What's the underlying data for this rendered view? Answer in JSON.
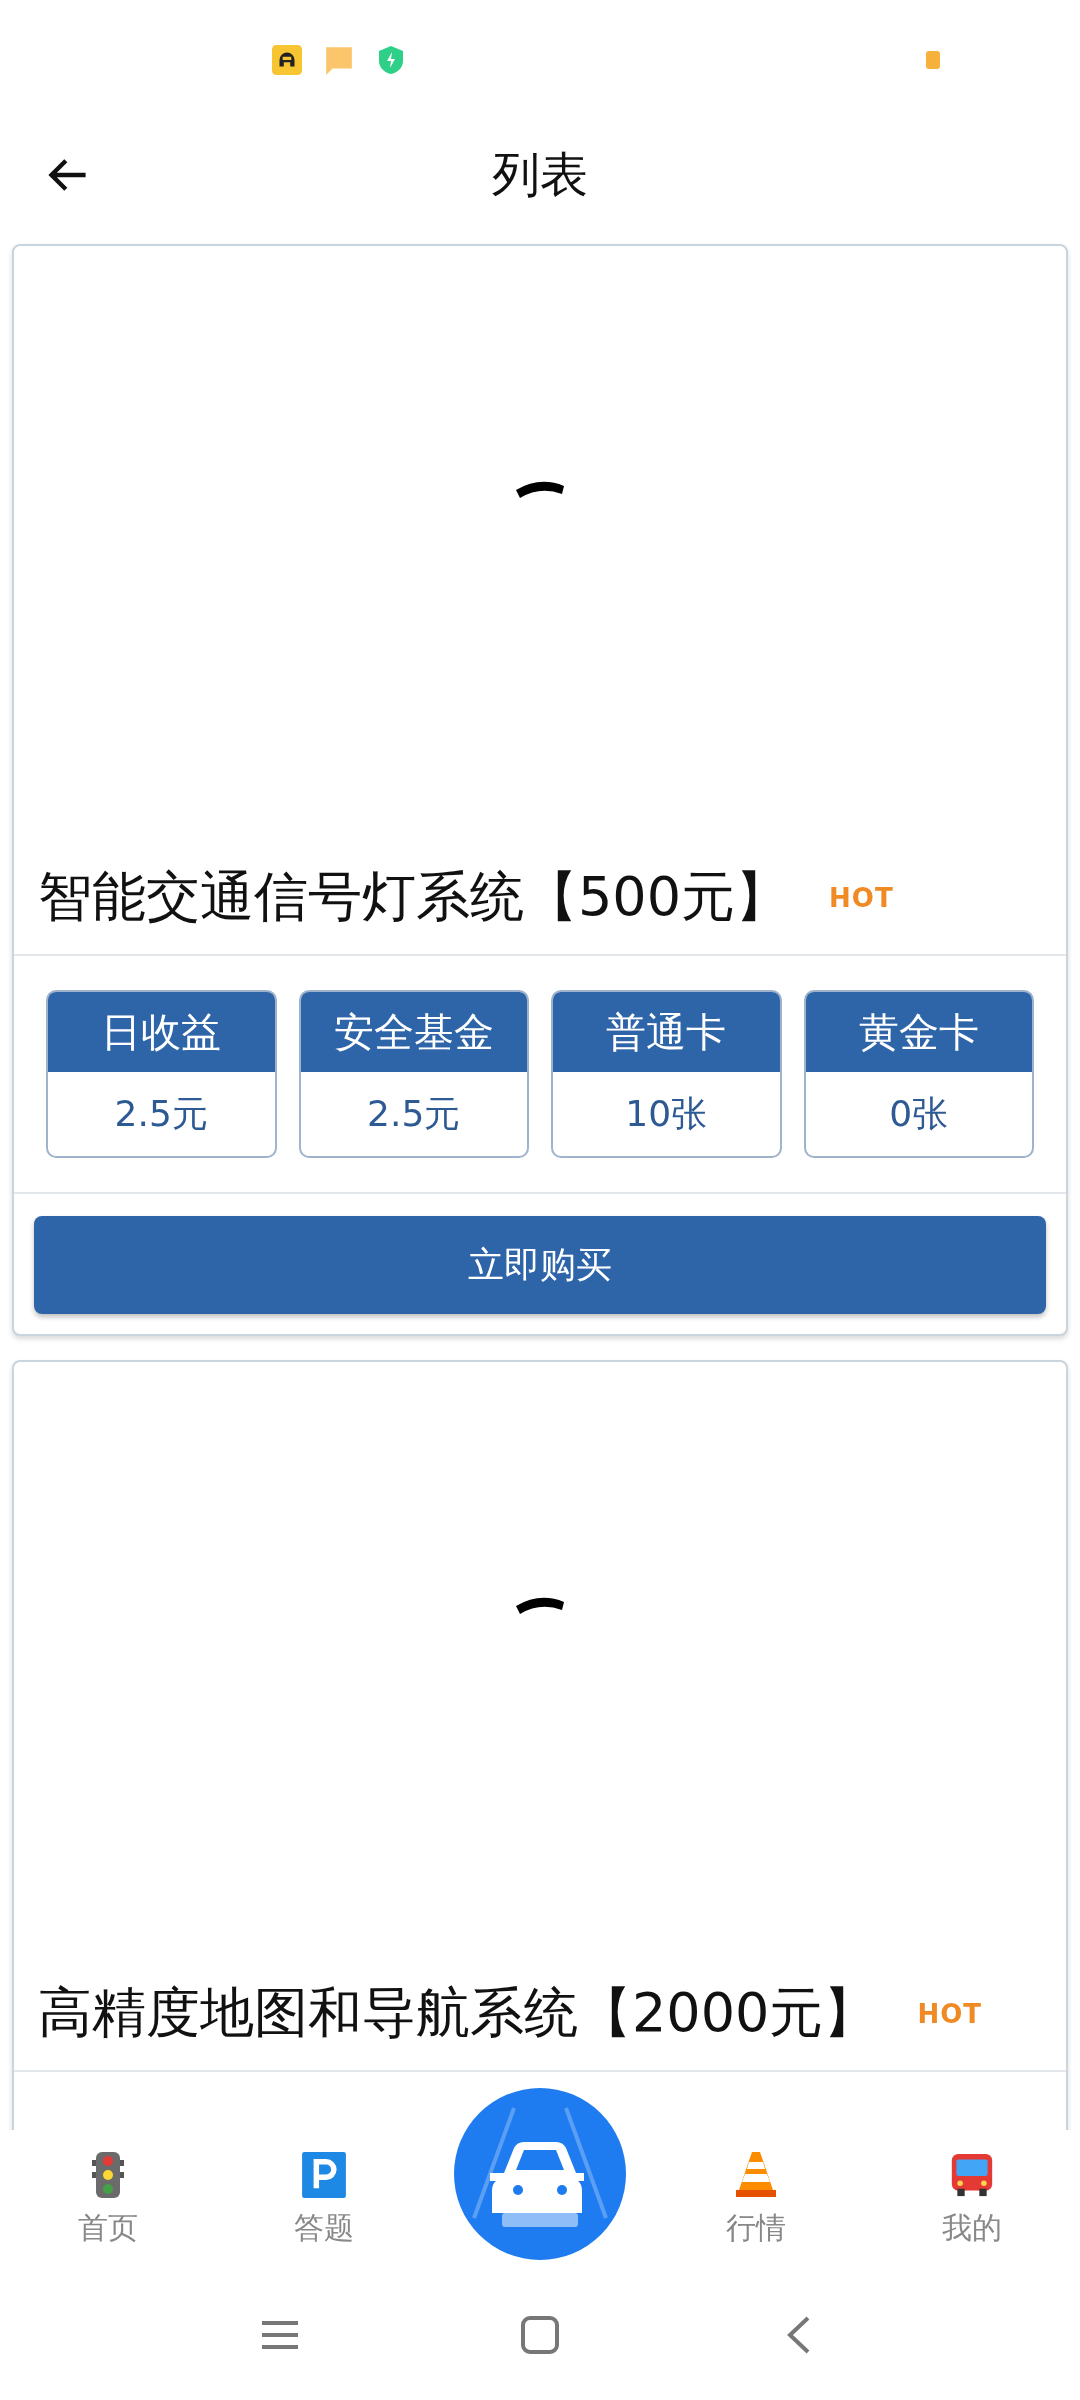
{
  "header": {
    "title": "列表"
  },
  "products": [
    {
      "title": "智能交通信号灯系统【500元】",
      "badge": "HOT",
      "loading": true,
      "stats": [
        {
          "label": "日收益",
          "value": "2.5元"
        },
        {
          "label": "安全基金",
          "value": "2.5元"
        },
        {
          "label": "普通卡",
          "value": "10张"
        },
        {
          "label": "黄金卡",
          "value": "0张"
        }
      ],
      "button": "立即购买"
    },
    {
      "title": "高精度地图和导航系统【2000元】",
      "badge": "HOT",
      "loading": true
    }
  ],
  "tab_bar": [
    {
      "kind": "traffic-light",
      "label": "首页"
    },
    {
      "kind": "parking",
      "label": "答题"
    },
    {
      "kind": "center"
    },
    {
      "kind": "cone",
      "label": "行情"
    },
    {
      "kind": "bus",
      "label": "我的"
    }
  ]
}
